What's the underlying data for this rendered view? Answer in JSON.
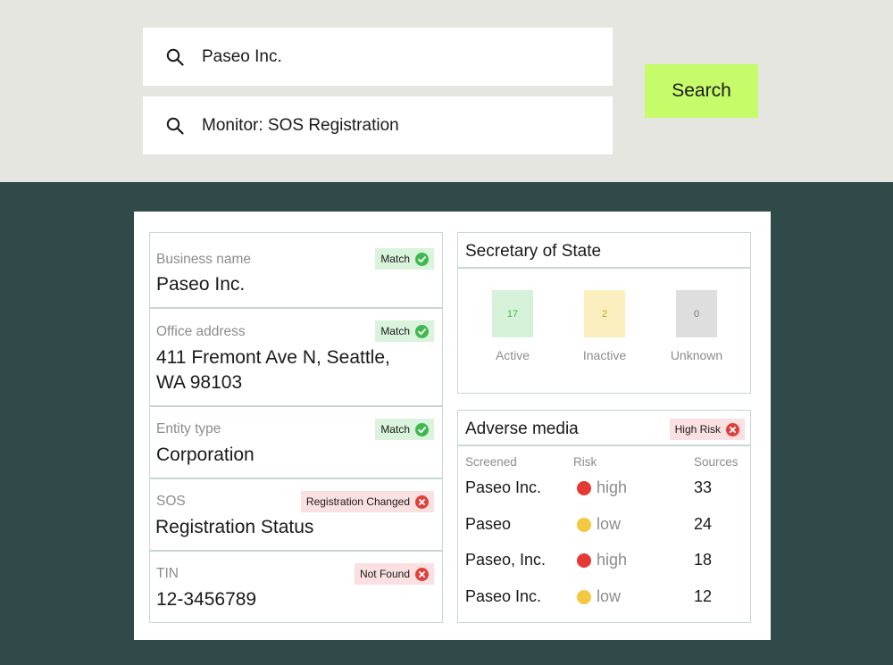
{
  "search": {
    "query": "Paseo Inc.",
    "monitor": "Monitor: SOS Registration",
    "button_label": "Search"
  },
  "fields": [
    {
      "label": "Business name",
      "value": "Paseo Inc.",
      "badge": "Match",
      "status": "match"
    },
    {
      "label": "Office address",
      "value_line1": "411 Fremont Ave N, Seattle,",
      "value_line2": "WA 98103",
      "badge": "Match",
      "status": "match"
    },
    {
      "label": "Entity type",
      "value": "Corporation",
      "badge": "Match",
      "status": "match"
    },
    {
      "label": "SOS",
      "value": "Registration Status",
      "badge": "Registration Changed",
      "status": "bad"
    },
    {
      "label": "TIN",
      "value": "12-3456789",
      "badge": "Not Found",
      "status": "bad"
    }
  ],
  "sos": {
    "title": "Secretary of State",
    "stats": [
      {
        "label": "Active",
        "count": "17",
        "bg": "#d6f3d9",
        "fg": "#3fb94f"
      },
      {
        "label": "Inactive",
        "count": "2",
        "bg": "#fbefc0",
        "fg": "#c9a21a"
      },
      {
        "label": "Unknown",
        "count": "0",
        "bg": "#dedede",
        "fg": "#777777"
      }
    ]
  },
  "media": {
    "title": "Adverse media",
    "badge": "High Risk",
    "columns": [
      "Screened",
      "Risk",
      "Sources"
    ],
    "rows": [
      {
        "name": "Paseo Inc.",
        "risk": "high",
        "sources": "33"
      },
      {
        "name": "Paseo",
        "risk": "low",
        "sources": "24"
      },
      {
        "name": "Paseo, Inc.",
        "risk": "high",
        "sources": "18"
      },
      {
        "name": "Paseo Inc.",
        "risk": "low",
        "sources": "12"
      }
    ]
  },
  "colors": {
    "top_bg": "#e6e6e1",
    "page_bg": "#2f4a48",
    "accent": "#c6fb6a",
    "match_green": "#3fb94f",
    "error_red": "#e0403c",
    "risk_high": "#e53935",
    "risk_low": "#f5c842"
  }
}
